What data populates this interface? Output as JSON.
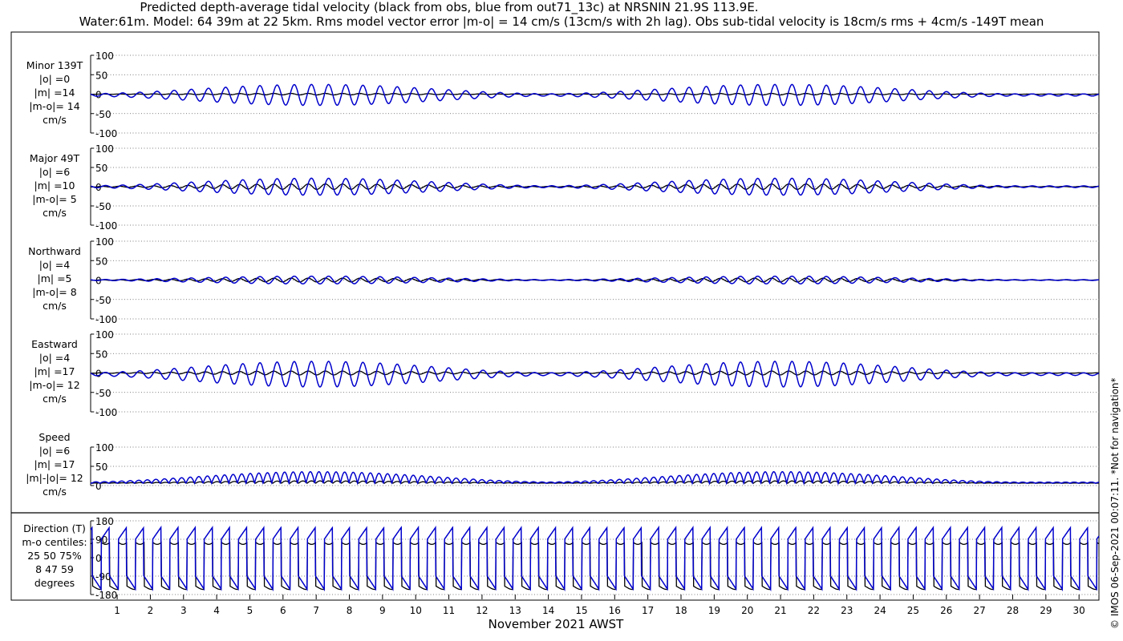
{
  "header": {
    "title_line1": "Predicted depth-average tidal velocity (black from obs, blue from out71_13c) at NRSNIN 21.9S 113.9E.",
    "title_line2": "Water:61m. Model: 64 39m at 22 5km. Rms model vector error |m-o| = 14 cm/s (13cm/s with 2h lag). Obs sub-tidal velocity is 18cm/s rms + 4cm/s -149T mean"
  },
  "footer": {
    "xlabel": "November 2021 AWST",
    "stamp": "© IMOS 06-Sep-2021 00:07:11. *Not for navigation*"
  },
  "colors": {
    "obs": "#000000",
    "model": "#0000cc"
  },
  "chart_data": [
    {
      "type": "line",
      "id": "minor",
      "label_lines": [
        "Minor 139T",
        "|o| =0",
        "|m| =14",
        "|m-o|= 14",
        "cm/s"
      ],
      "ylim": [
        -100,
        100
      ],
      "ticks": [
        -100,
        -50,
        0,
        50,
        100
      ],
      "yticklabels": [
        "-100",
        "-50",
        "0",
        "50",
        "100"
      ],
      "obs": {
        "amplitude_cm_s": 2,
        "mean_cm_s": 0
      },
      "model": {
        "amplitude_cm_s": 14,
        "peak_cm_s": 27,
        "mean_cm_s": -2
      }
    },
    {
      "type": "line",
      "id": "major",
      "label_lines": [
        "Major 49T",
        "|o| =6",
        "|m| =10",
        "|m-o|= 5",
        "cm/s"
      ],
      "ylim": [
        -100,
        100
      ],
      "ticks": [
        -100,
        -50,
        0,
        50,
        100
      ],
      "yticklabels": [
        "-100",
        "-50",
        "0",
        "50",
        "100"
      ],
      "obs": {
        "amplitude_cm_s": 7,
        "mean_cm_s": 0
      },
      "model": {
        "amplitude_cm_s": 10,
        "peak_cm_s": 22,
        "mean_cm_s": 0
      }
    },
    {
      "type": "line",
      "id": "northward",
      "label_lines": [
        "Northward",
        "|o| =4",
        "|m| =5",
        "|m-o|= 8",
        "cm/s"
      ],
      "ylim": [
        -100,
        100
      ],
      "ticks": [
        -100,
        -50,
        0,
        50,
        100
      ],
      "yticklabels": [
        "-100",
        "-50",
        "0",
        "50",
        "100"
      ],
      "obs": {
        "amplitude_cm_s": 5,
        "mean_cm_s": 0
      },
      "model": {
        "amplitude_cm_s": 5,
        "peak_cm_s": 10,
        "mean_cm_s": 0
      }
    },
    {
      "type": "line",
      "id": "eastward",
      "label_lines": [
        "Eastward",
        "|o| =4",
        "|m| =17",
        "|m-o|= 12",
        "cm/s"
      ],
      "ylim": [
        -100,
        100
      ],
      "ticks": [
        -100,
        -50,
        0,
        50,
        100
      ],
      "yticklabels": [
        "-100",
        "-50",
        "0",
        "50",
        "100"
      ],
      "obs": {
        "amplitude_cm_s": 5,
        "mean_cm_s": 0
      },
      "model": {
        "amplitude_cm_s": 17,
        "peak_cm_s": 33,
        "mean_cm_s": -3
      }
    },
    {
      "type": "line",
      "id": "speed",
      "label_lines": [
        "Speed",
        "|o| =6",
        "|m| =17",
        "|m|-|o|= 12",
        "cm/s"
      ],
      "ylim": [
        0,
        100
      ],
      "ticks": [
        0,
        50,
        100
      ],
      "yticklabels": [
        "0",
        "50",
        "100"
      ],
      "obs": {
        "amplitude_cm_s": 6,
        "mean_cm_s": 6
      },
      "model": {
        "amplitude_cm_s": 17,
        "peak_cm_s": 38,
        "mean_cm_s": 15
      }
    },
    {
      "type": "line",
      "id": "direction",
      "label_lines": [
        "Direction (T)",
        "m-o centiles:",
        "25  50  75%",
        "8  47  59",
        "degrees"
      ],
      "ylim": [
        -180,
        180
      ],
      "ticks": [
        -180,
        -90,
        0,
        90,
        180
      ],
      "yticklabels": [
        "-180",
        "-90",
        "0",
        "90",
        "180"
      ],
      "obs": {
        "low_deg": -145,
        "high_deg": 75
      },
      "model": {
        "low_deg": -160,
        "high_deg": 150
      }
    }
  ],
  "x_axis": {
    "unit": "day of November 2021",
    "xlim": [
      0.2,
      30.6
    ],
    "ticks": [
      1,
      2,
      3,
      4,
      5,
      6,
      7,
      8,
      9,
      10,
      11,
      12,
      13,
      14,
      15,
      16,
      17,
      18,
      19,
      20,
      21,
      22,
      23,
      24,
      25,
      26,
      27,
      28,
      29,
      30
    ],
    "ticklabels": [
      "1",
      "2",
      "3",
      "4",
      "5",
      "6",
      "7",
      "8",
      "9",
      "10",
      "11",
      "12",
      "13",
      "14",
      "15",
      "16",
      "17",
      "18",
      "19",
      "20",
      "21",
      "22",
      "23",
      "24",
      "25",
      "26",
      "27",
      "28",
      "29",
      "30"
    ],
    "tidal_period_hours": 12.42,
    "spring_tide_days": [
      7,
      21
    ]
  },
  "grid": true
}
